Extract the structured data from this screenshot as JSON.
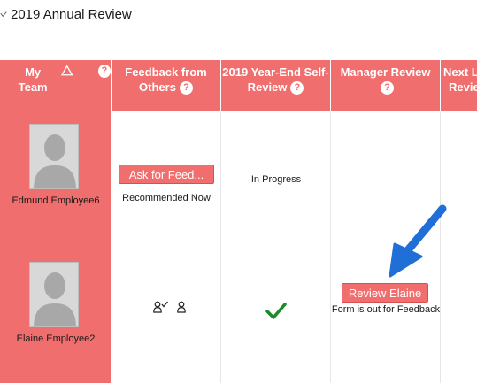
{
  "page": {
    "title": "2019 Annual Review"
  },
  "table": {
    "headers": [
      {
        "label": "My Team"
      },
      {
        "line1": "Feedback from",
        "line2": "Others"
      },
      {
        "line1": "2019 Year-End Self-",
        "line2": "Review"
      },
      {
        "line1": "Manager Review"
      },
      {
        "line1": "Next L",
        "line2": "Revie"
      }
    ],
    "rows": [
      {
        "employee": "Edmund Employee6",
        "feedback_button": "Ask for Feed...",
        "feedback_note": "Recommended Now",
        "self_review": "In Progress"
      },
      {
        "employee": "Elaine Employee2",
        "manager_button": "Review Elaine",
        "manager_note": "Form is out for Feedback"
      }
    ]
  },
  "colors": {
    "accent": "#f06e6e",
    "check": "#1a8a2a",
    "arrow": "#1f6fd6"
  },
  "icons": {
    "header_chevron": "chevron-down-icon",
    "sort": "triangle-icon",
    "help": "help-icon",
    "check": "checkmark-icon",
    "person": "person-icon",
    "arrow": "arrow-icon"
  }
}
